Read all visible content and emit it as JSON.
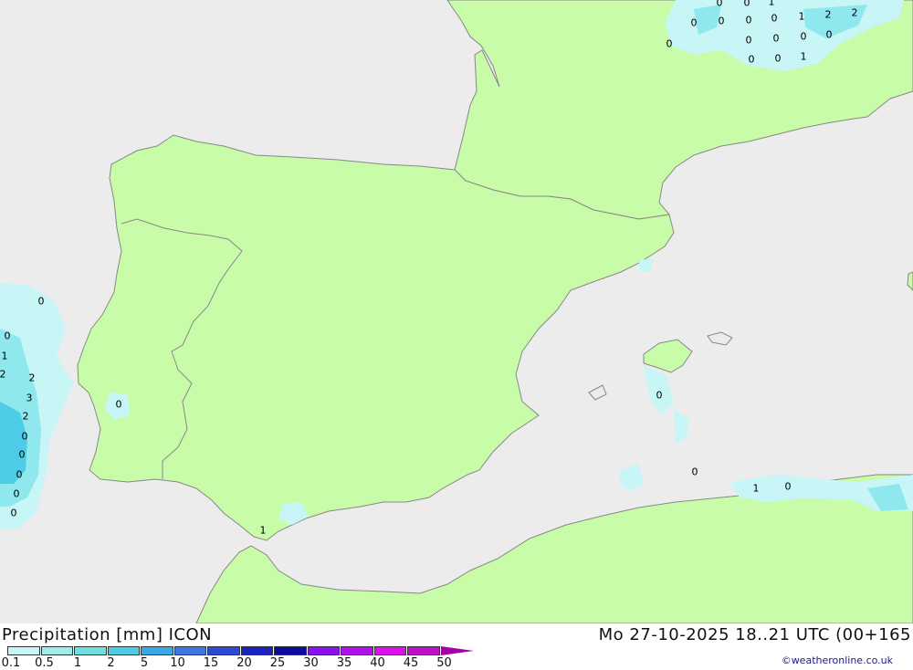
{
  "footer": {
    "title": "Precipitation [mm] ICON",
    "datetime": "Mo 27-10-2025 18..21 UTC (00+165",
    "credit": "©weatheronline.co.uk"
  },
  "legend": [
    {
      "label": "0.1",
      "color": "#c8f5f5"
    },
    {
      "label": "0.5",
      "color": "#a0ecec"
    },
    {
      "label": "1",
      "color": "#6ee0e0"
    },
    {
      "label": "2",
      "color": "#4ccce6"
    },
    {
      "label": "5",
      "color": "#3aa8e6"
    },
    {
      "label": "10",
      "color": "#3c78e0"
    },
    {
      "label": "15",
      "color": "#2c4ad8"
    },
    {
      "label": "20",
      "color": "#1c22c0"
    },
    {
      "label": "25",
      "color": "#0c0c9a"
    },
    {
      "label": "30",
      "color": "#8a10f0"
    },
    {
      "label": "35",
      "color": "#b010ec"
    },
    {
      "label": "40",
      "color": "#dc10ec"
    },
    {
      "label": "45",
      "color": "#c010c8"
    },
    {
      "label": "50",
      "color": "#a800a8"
    }
  ],
  "colors": {
    "sea": "#ececec",
    "land": "#c8fca8",
    "border": "#888888",
    "precip_light": "#c8f5f5",
    "precip_mid": "#8ee8ee",
    "precip_heavy": "#4ccce6"
  },
  "values": [
    {
      "text": "0"
    },
    {
      "text": "0"
    },
    {
      "text": "0"
    },
    {
      "text": "0"
    },
    {
      "text": "1"
    },
    {
      "text": "2"
    },
    {
      "text": "2"
    },
    {
      "text": "0"
    },
    {
      "text": "0"
    },
    {
      "text": "0"
    },
    {
      "text": "0"
    },
    {
      "text": "0"
    },
    {
      "text": "0"
    },
    {
      "text": "0"
    },
    {
      "text": "1"
    },
    {
      "text": "0"
    },
    {
      "text": "0"
    },
    {
      "text": "1"
    },
    {
      "text": "0"
    },
    {
      "text": "0"
    },
    {
      "text": "1"
    },
    {
      "text": "2"
    },
    {
      "text": "2"
    },
    {
      "text": "3"
    },
    {
      "text": "2"
    },
    {
      "text": "0"
    },
    {
      "text": "0"
    },
    {
      "text": "0"
    },
    {
      "text": "0"
    },
    {
      "text": "0"
    },
    {
      "text": "0"
    },
    {
      "text": "1"
    },
    {
      "text": "0"
    },
    {
      "text": "0"
    },
    {
      "text": "1"
    },
    {
      "text": "0"
    }
  ]
}
